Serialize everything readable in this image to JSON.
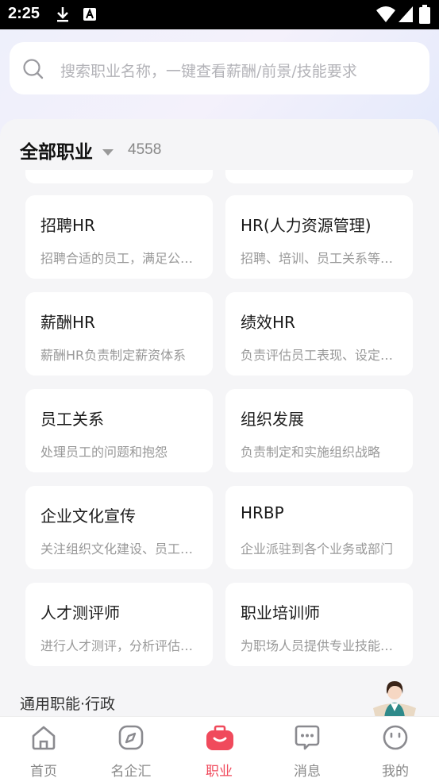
{
  "status_bar": {
    "time": "2:25",
    "icons": [
      "download-icon",
      "notification-a-icon",
      "wifi-icon",
      "signal-icon",
      "battery-icon"
    ]
  },
  "search": {
    "placeholder": "搜索职业名称，一键查看薪酬/前景/技能要求"
  },
  "filter": {
    "label": "全部职业",
    "count": "4558"
  },
  "cards": [
    {
      "name": "招聘HR",
      "desc": "招聘合适的员工，满足公司的用人需求"
    },
    {
      "name": "HR(人力资源管理)",
      "desc": "招聘、培训、员工关系等工作"
    },
    {
      "name": "薪酬HR",
      "desc": "薪酬HR负责制定薪资体系"
    },
    {
      "name": "绩效HR",
      "desc": "负责评估员工表现、设定目标"
    },
    {
      "name": "员工关系",
      "desc": "处理员工的问题和抱怨"
    },
    {
      "name": "组织发展",
      "desc": "负责制定和实施组织战略"
    },
    {
      "name": "企业文化宣传",
      "desc": "关注组织文化建设、员工活动"
    },
    {
      "name": "HRBP",
      "desc": "企业派驻到各个业务或部门"
    },
    {
      "name": "人才测评师",
      "desc": "进行人才测评，分析评估结果"
    },
    {
      "name": "职业培训师",
      "desc": "为职场人员提供专业技能培训"
    }
  ],
  "next_section": "通用职能·行政",
  "tabs": [
    {
      "label": "首页",
      "icon": "home-icon",
      "active": false
    },
    {
      "label": "名企汇",
      "icon": "compass-icon",
      "active": false
    },
    {
      "label": "职业",
      "icon": "briefcase-icon",
      "active": true
    },
    {
      "label": "消息",
      "icon": "message-icon",
      "active": false
    },
    {
      "label": "我的",
      "icon": "profile-icon",
      "active": false
    }
  ],
  "colors": {
    "accent": "#f04a5c",
    "inactive": "#888888"
  }
}
